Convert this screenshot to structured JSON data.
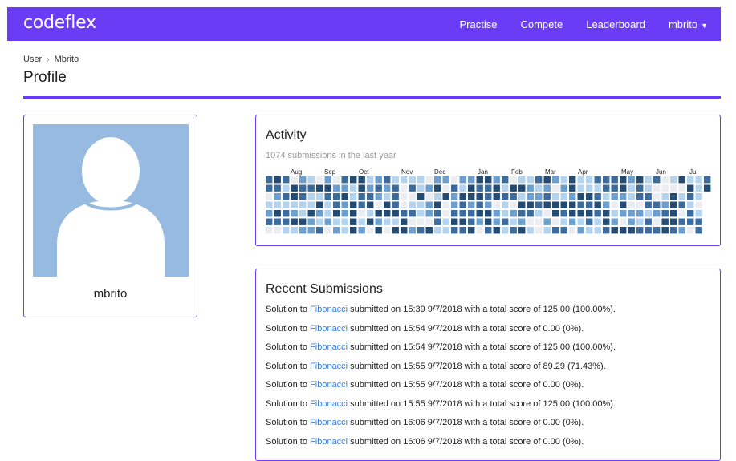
{
  "navbar": {
    "brand": "codeflex",
    "links": [
      "Practise",
      "Compete",
      "Leaderboard"
    ],
    "user_menu": "mbrito",
    "bg_color": "#6a3cf5"
  },
  "breadcrumb": {
    "root": "User",
    "separator": "›",
    "current": "Mbrito"
  },
  "page_title": "Profile",
  "profile": {
    "username": "mbrito",
    "avatar_icon": "user-silhouette-icon"
  },
  "activity": {
    "title": "Activity",
    "subtitle": "1074 submissions in the last year",
    "months": [
      "Aug",
      "Sep",
      "Oct",
      "Nov",
      "Dec",
      "Jan",
      "Feb",
      "Mar",
      "Apr",
      "May",
      "Jun",
      "Jul"
    ],
    "colors": [
      "#ebedf0",
      "#b3d3ef",
      "#6b9fd0",
      "#3c6c9e",
      "#234b73"
    ]
  },
  "recent": {
    "title": "Recent Submissions",
    "items": [
      {
        "prefix": "Solution to ",
        "problem": "Fibonacci",
        "suffix": " submitted on 15:39 9/7/2018 with a total score of 125.00 (100.00%)."
      },
      {
        "prefix": "Solution to ",
        "problem": "Fibonacci",
        "suffix": " submitted on 15:54 9/7/2018 with a total score of 0.00 (0%)."
      },
      {
        "prefix": "Solution to ",
        "problem": "Fibonacci",
        "suffix": " submitted on 15:54 9/7/2018 with a total score of 125.00 (100.00%)."
      },
      {
        "prefix": "Solution to ",
        "problem": "Fibonacci",
        "suffix": " submitted on 15:55 9/7/2018 with a total score of 89.29 (71.43%)."
      },
      {
        "prefix": "Solution to ",
        "problem": "Fibonacci",
        "suffix": " submitted on 15:55 9/7/2018 with a total score of 0.00 (0%)."
      },
      {
        "prefix": "Solution to ",
        "problem": "Fibonacci",
        "suffix": " submitted on 15:55 9/7/2018 with a total score of 125.00 (100.00%)."
      },
      {
        "prefix": "Solution to ",
        "problem": "Fibonacci",
        "suffix": " submitted on 16:06 9/7/2018 with a total score of 0.00 (0%)."
      },
      {
        "prefix": "Solution to ",
        "problem": "Fibonacci",
        "suffix": " submitted on 16:06 9/7/2018 with a total score of 0.00 (0%)."
      }
    ]
  }
}
